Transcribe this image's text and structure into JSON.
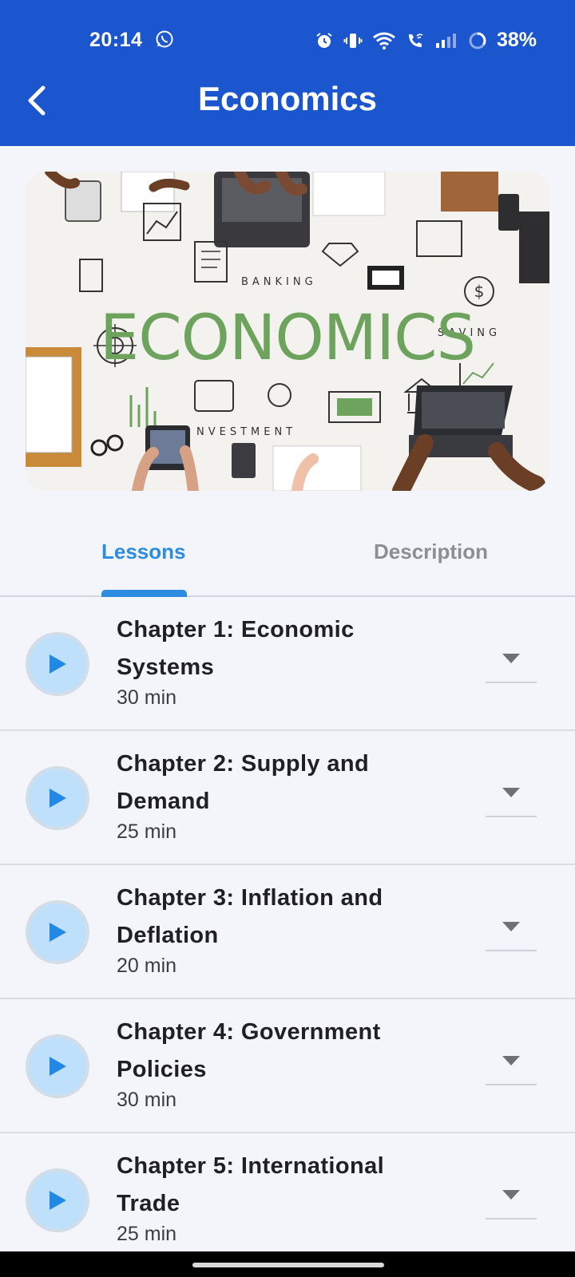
{
  "status_bar": {
    "time": "20:14",
    "battery": "38%",
    "icons": [
      "whatsapp-icon",
      "alarm-icon",
      "vibrate-icon",
      "wifi-icon",
      "wifi-call-icon",
      "signal-icon",
      "battery-ring-icon"
    ]
  },
  "header": {
    "title": "Economics",
    "back_icon": "chevron-left-icon",
    "background": "#1c56cf"
  },
  "hero": {
    "title_word": "ECONOMICS",
    "doodles": [
      "BANKING",
      "SAVING",
      "NVESTMENT"
    ]
  },
  "tabs": [
    {
      "label": "Lessons",
      "active": true
    },
    {
      "label": "Description",
      "active": false
    }
  ],
  "lessons": [
    {
      "title": "Chapter 1: Economic Systems",
      "duration": "30 min"
    },
    {
      "title": "Chapter 2: Supply and Demand",
      "duration": "25 min"
    },
    {
      "title": "Chapter 3: Inflation and Deflation",
      "duration": "20 min"
    },
    {
      "title": "Chapter 4: Government Policies",
      "duration": "30 min"
    },
    {
      "title": "Chapter 5: International Trade",
      "duration": "25 min"
    }
  ],
  "colors": {
    "accent": "#2b8ce0",
    "play_bg": "#bfe0fb",
    "play_icon": "#2188e6"
  }
}
